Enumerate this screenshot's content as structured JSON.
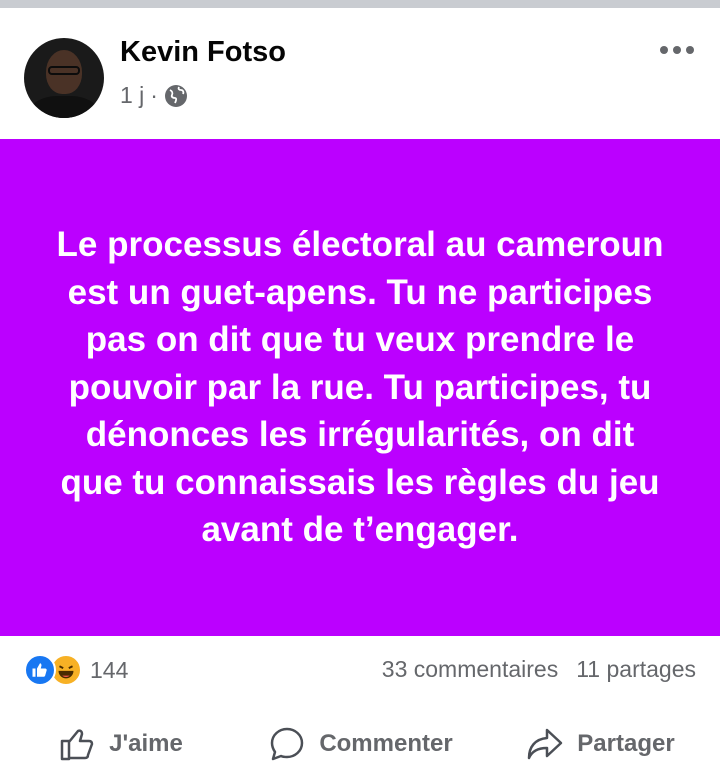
{
  "post": {
    "author": "Kevin Fotso",
    "time": "1 j",
    "separator": "·",
    "text": "Le processus électoral au cameroun est un guet-apens. Tu ne participes pas on dit que tu veux prendre le pouvoir par la rue. Tu participes, tu dénonces les irrégularités, on dit que tu connaissais les règles du jeu avant de t’engager.",
    "background_color": "#bb00ff"
  },
  "stats": {
    "reactions_count": "144",
    "comments": "33 commentaires",
    "shares": "11 partages"
  },
  "actions": {
    "like": "J'aime",
    "comment": "Commenter",
    "share": "Partager"
  },
  "icons": [
    "globe-icon",
    "more-options-icon",
    "like-reaction-icon",
    "haha-reaction-icon",
    "thumbs-up-icon",
    "comment-icon",
    "share-icon"
  ]
}
